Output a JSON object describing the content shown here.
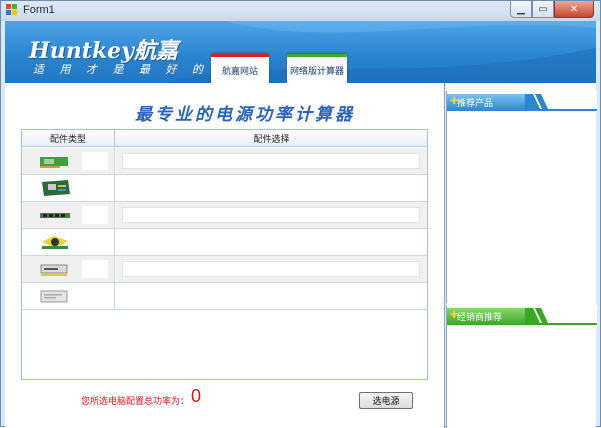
{
  "window": {
    "title": "Form1"
  },
  "header": {
    "logo": "Huntkey航嘉",
    "slogan": "适 用 才 是 最 好 的 ！",
    "tabs": [
      "航嘉网站",
      "网络版计算器"
    ]
  },
  "main": {
    "title": "最专业的电源功率计算器",
    "table": {
      "columns": [
        "配件类型",
        "配件选择"
      ],
      "rows": [
        {
          "icon": "graphics-card-icon"
        },
        {
          "icon": "motherboard-icon"
        },
        {
          "icon": "memory-module-icon"
        },
        {
          "icon": "cpu-fan-icon"
        },
        {
          "icon": "optical-drive-icon"
        },
        {
          "icon": "hard-drive-icon"
        }
      ]
    },
    "total_label": "您所选电脑配置总功率为：",
    "total_value": "0",
    "select_button": "选电源"
  },
  "sidebar": {
    "recommend_title": "推荐产品",
    "dealer_title": "经销商推荐"
  },
  "colors": {
    "header_blue": "#2a83cf",
    "accent_red": "#d01818",
    "tab_green": "#3cab2b"
  }
}
